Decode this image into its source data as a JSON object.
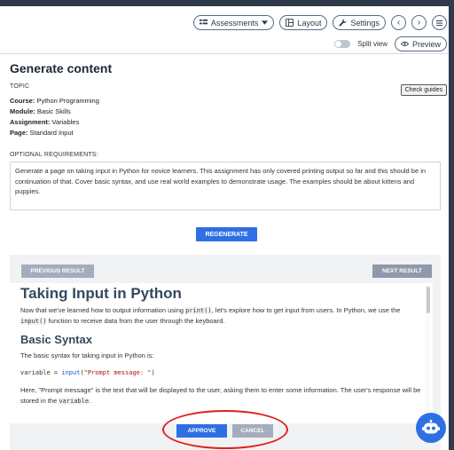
{
  "toolbar": {
    "assessments_label": "Assessments",
    "layout_label": "Layout",
    "settings_label": "Settings",
    "split_view_label": "Split view",
    "preview_label": "Preview"
  },
  "page": {
    "title": "Generate content",
    "topic_label": "TOPIC",
    "check_guides_label": "Check guides",
    "meta": [
      {
        "key": "Course:",
        "value": "Python Programming"
      },
      {
        "key": "Module:",
        "value": "Basic Skills"
      },
      {
        "key": "Assignment:",
        "value": "Variables"
      },
      {
        "key": "Page:",
        "value": "Standard Input"
      }
    ],
    "optional_label": "OPTIONAL REQUIREMENTS:",
    "requirements_text": "Generate a page on taking input in Python for novice learners. This assignment has only covered printing output so far and this should be in continuation of that. Cover basic syntax, and use real world examples to demonstrate usage. The examples should be about kittens and puppies.",
    "regenerate_label": "REGENERATE"
  },
  "result": {
    "prev_label": "PREVIOUS RESULT",
    "next_label": "NEXT RESULT",
    "heading": "Taking Input in Python",
    "intro_a": "Now that we've learned how to output information using ",
    "intro_code1": "print()",
    "intro_b": ", let's explore how to get input from users. In Python, we use the ",
    "intro_code2": "input()",
    "intro_c": " function to receive data from the user through the keyboard.",
    "subheading": "Basic Syntax",
    "syntax_text": "The basic syntax for taking input in Python is:",
    "code_var": "variable = ",
    "code_fn": "input",
    "code_open": "(",
    "code_str": "\"Prompt message: \"",
    "code_close": ")",
    "explain_a": "Here, \"Prompt message\" is the text that will be displayed to the user, asking them to enter some information. The user's response will be stored in the ",
    "explain_code": "variable",
    "explain_b": "."
  },
  "actions": {
    "approve_label": "APPROVE",
    "cancel_label": "CANCEL"
  },
  "colors": {
    "primary": "#2f6fe4",
    "secondary_button": "#a4adbd",
    "highlight_ring": "#e02020"
  }
}
